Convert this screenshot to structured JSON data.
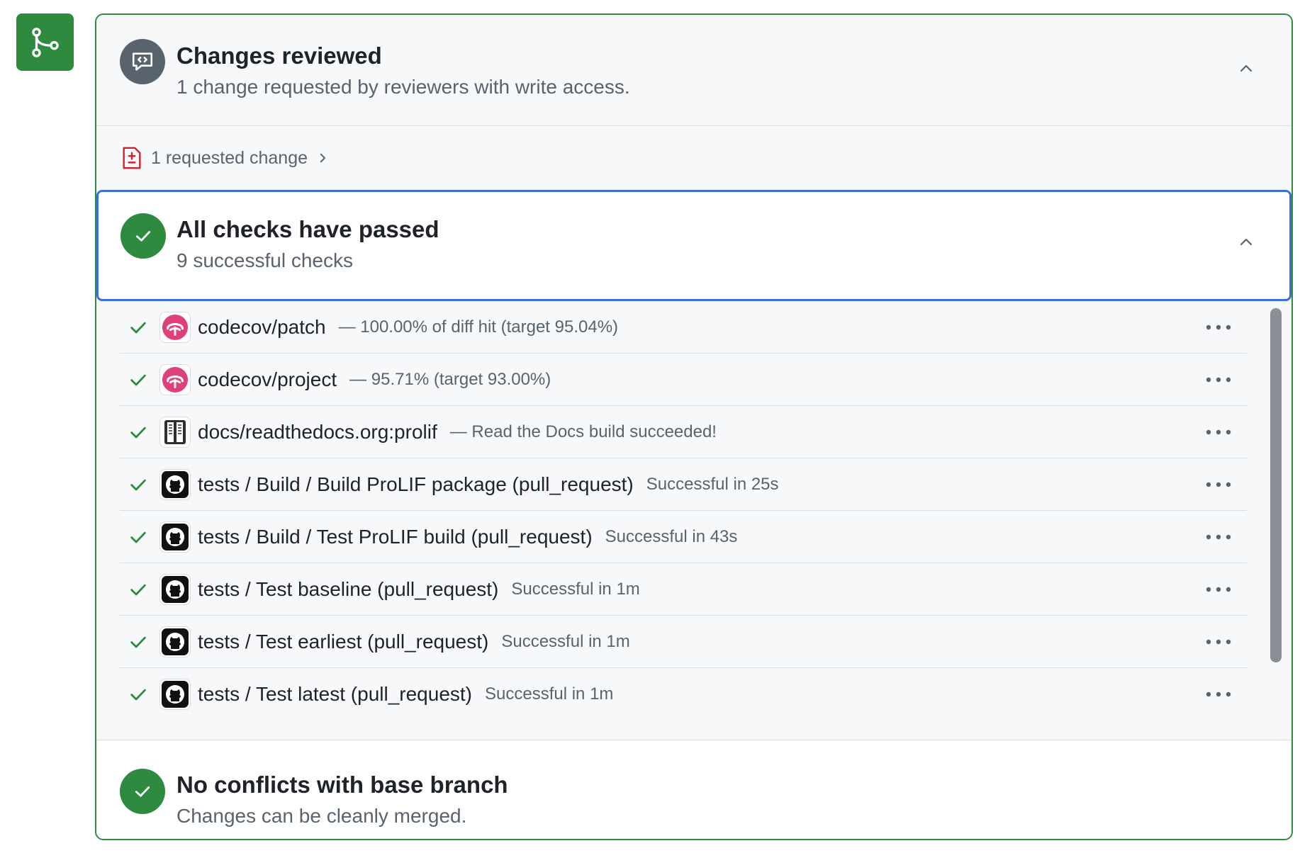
{
  "colors": {
    "success": "#2d8a3e",
    "focus_border": "#3a6fd8",
    "danger": "#cf222e",
    "muted": "#59636e",
    "codecov": "#e0407a"
  },
  "merge_badge": {
    "icon": "git-merge-icon"
  },
  "review": {
    "title": "Changes reviewed",
    "subtitle": "1 change requested by reviewers with write access.",
    "icon": "code-review-icon",
    "requested_link": "1 requested change"
  },
  "checks": {
    "title": "All checks have passed",
    "subtitle": "9 successful checks",
    "items": [
      {
        "name": "codecov/patch",
        "desc": "— 100.00% of diff hit (target 95.04%)",
        "icon": "codecov-icon"
      },
      {
        "name": "codecov/project",
        "desc": "— 95.71% (target 93.00%)",
        "icon": "codecov-icon"
      },
      {
        "name": "docs/readthedocs.org:prolif",
        "desc": "— Read the Docs build succeeded!",
        "icon": "readthedocs-icon"
      },
      {
        "name": "tests / Build / Build ProLIF package (pull_request)",
        "desc": "Successful in 25s",
        "icon": "github-icon"
      },
      {
        "name": "tests / Build / Test ProLIF build (pull_request)",
        "desc": "Successful in 43s",
        "icon": "github-icon"
      },
      {
        "name": "tests / Test baseline (pull_request)",
        "desc": "Successful in 1m",
        "icon": "github-icon"
      },
      {
        "name": "tests / Test earliest (pull_request)",
        "desc": "Successful in 1m",
        "icon": "github-icon"
      },
      {
        "name": "tests / Test latest (pull_request)",
        "desc": "Successful in 1m",
        "icon": "github-icon"
      }
    ]
  },
  "merge": {
    "title": "No conflicts with base branch",
    "subtitle": "Changes can be cleanly merged."
  }
}
